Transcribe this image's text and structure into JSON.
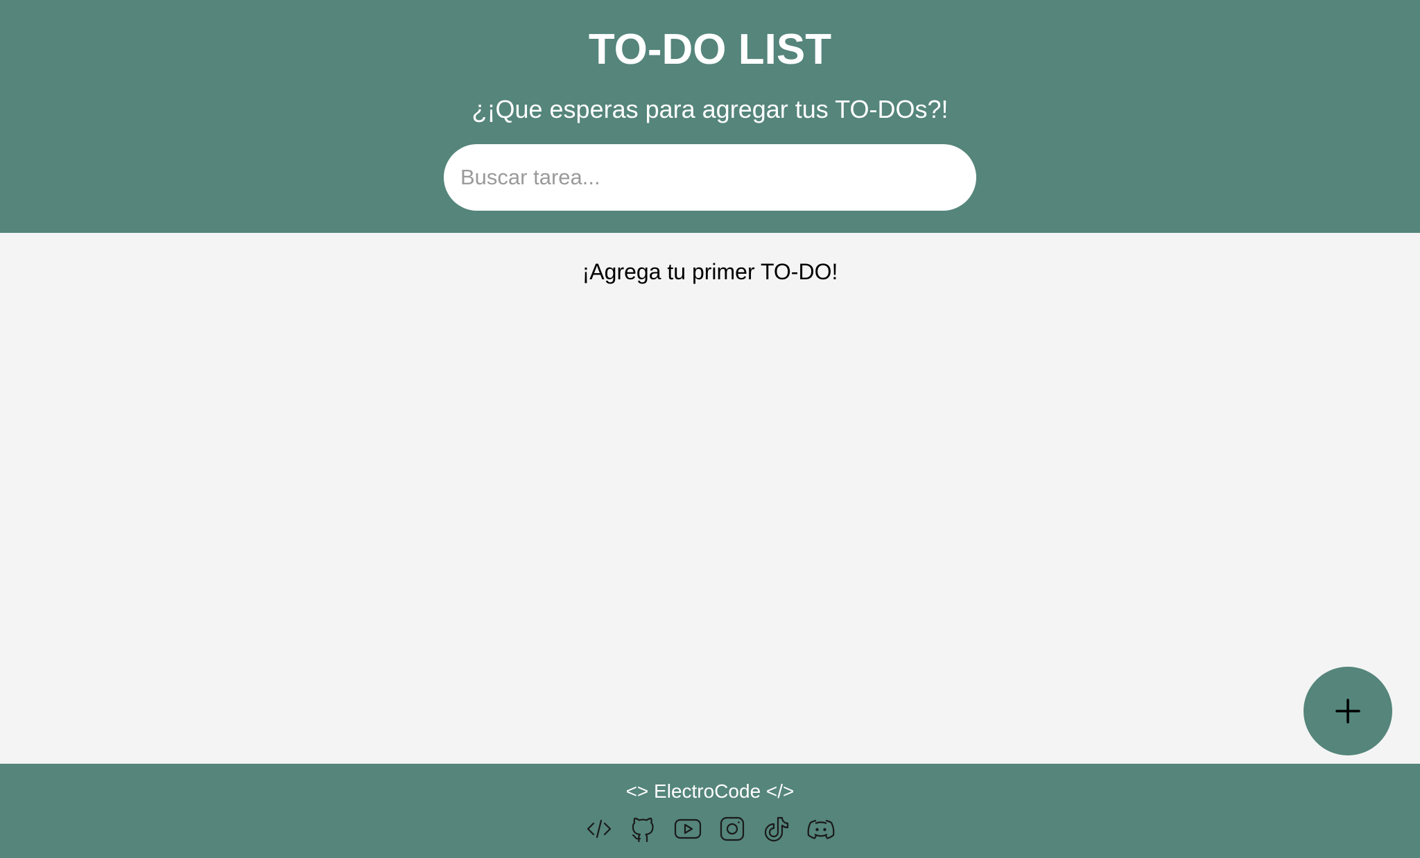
{
  "header": {
    "title": "TO-DO LIST",
    "subtitle": "¿¡Que esperas para agregar tus TO-DOs?!",
    "search_placeholder": "Buscar tarea..."
  },
  "main": {
    "empty_message": "¡Agrega tu primer TO-DO!"
  },
  "fab": {
    "icon": "plus-icon"
  },
  "footer": {
    "brand": "<> ElectroCode </>",
    "socials": [
      {
        "icon": "code-icon"
      },
      {
        "icon": "github-icon"
      },
      {
        "icon": "youtube-icon"
      },
      {
        "icon": "instagram-icon"
      },
      {
        "icon": "tiktok-icon"
      },
      {
        "icon": "discord-icon"
      }
    ]
  },
  "colors": {
    "primary": "#55857b",
    "background": "#f4f4f4",
    "header_text": "#ffffff"
  }
}
